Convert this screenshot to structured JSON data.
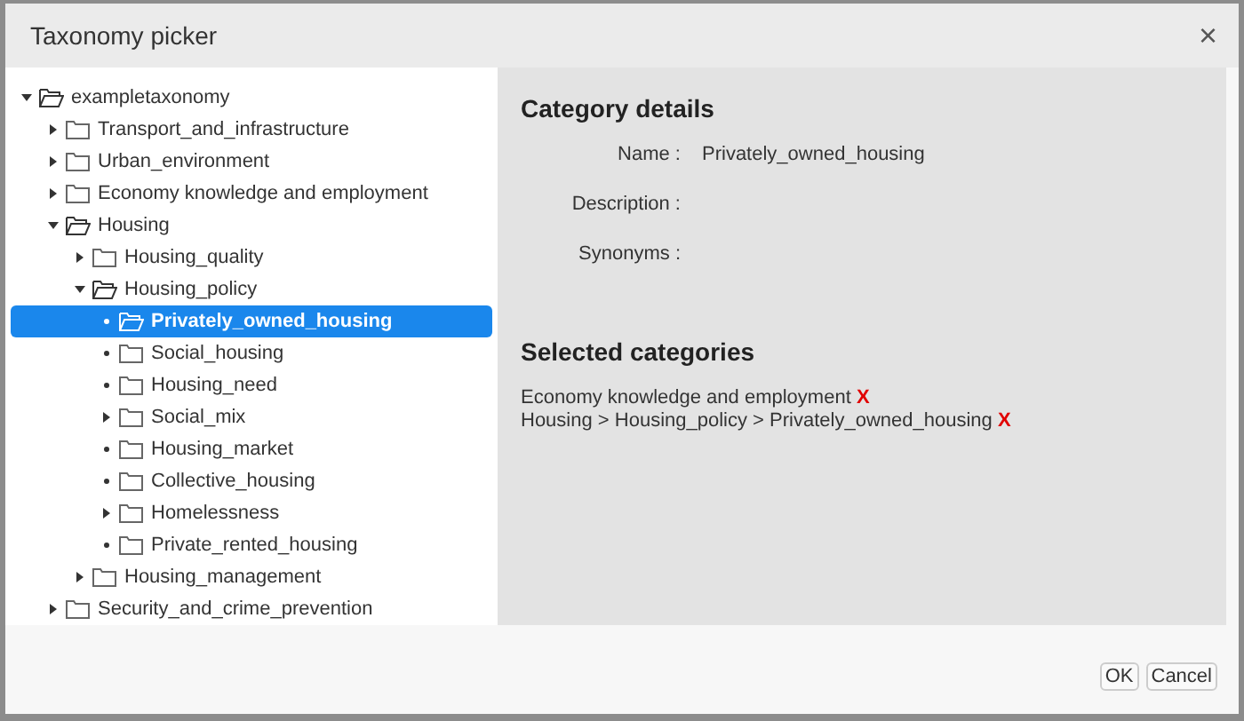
{
  "window": {
    "title": "Taxonomy picker",
    "close": "×"
  },
  "tree": [
    {
      "label": "exampletaxonomy",
      "kind": "expanded",
      "selected": false,
      "children": [
        {
          "label": "Transport_and_infrastructure",
          "kind": "collapsed",
          "selected": false
        },
        {
          "label": "Urban_environment",
          "kind": "collapsed",
          "selected": false
        },
        {
          "label": "Economy knowledge and employment",
          "kind": "collapsed",
          "selected": false
        },
        {
          "label": "Housing",
          "kind": "expanded",
          "selected": false,
          "children": [
            {
              "label": "Housing_quality",
              "kind": "collapsed",
              "selected": false
            },
            {
              "label": "Housing_policy",
              "kind": "expanded",
              "selected": false,
              "children": [
                {
                  "label": "Privately_owned_housing",
                  "kind": "leaf",
                  "selected": true
                },
                {
                  "label": "Social_housing",
                  "kind": "leaf",
                  "selected": false
                },
                {
                  "label": "Housing_need",
                  "kind": "leaf",
                  "selected": false
                },
                {
                  "label": "Social_mix",
                  "kind": "collapsed",
                  "selected": false
                },
                {
                  "label": "Housing_market",
                  "kind": "leaf",
                  "selected": false
                },
                {
                  "label": "Collective_housing",
                  "kind": "leaf",
                  "selected": false
                },
                {
                  "label": "Homelessness",
                  "kind": "collapsed",
                  "selected": false
                },
                {
                  "label": "Private_rented_housing",
                  "kind": "leaf",
                  "selected": false
                }
              ]
            },
            {
              "label": "Housing_management",
              "kind": "collapsed",
              "selected": false
            }
          ]
        },
        {
          "label": "Security_and_crime_prevention",
          "kind": "collapsed",
          "selected": false
        }
      ]
    }
  ],
  "details": {
    "title": "Category details",
    "fields": [
      {
        "label": "Name :",
        "value": "Privately_owned_housing"
      },
      {
        "label": "Description :"
      },
      {
        "label": "Synonyms :"
      }
    ]
  },
  "selected_categories": {
    "title": "Selected categories",
    "items": [
      {
        "path": "Economy knowledge and employment",
        "remove": "X"
      },
      {
        "path": "Housing > Housing_policy > Privately_owned_housing",
        "remove": "X"
      }
    ]
  },
  "buttons": [
    "OK",
    "Cancel"
  ]
}
